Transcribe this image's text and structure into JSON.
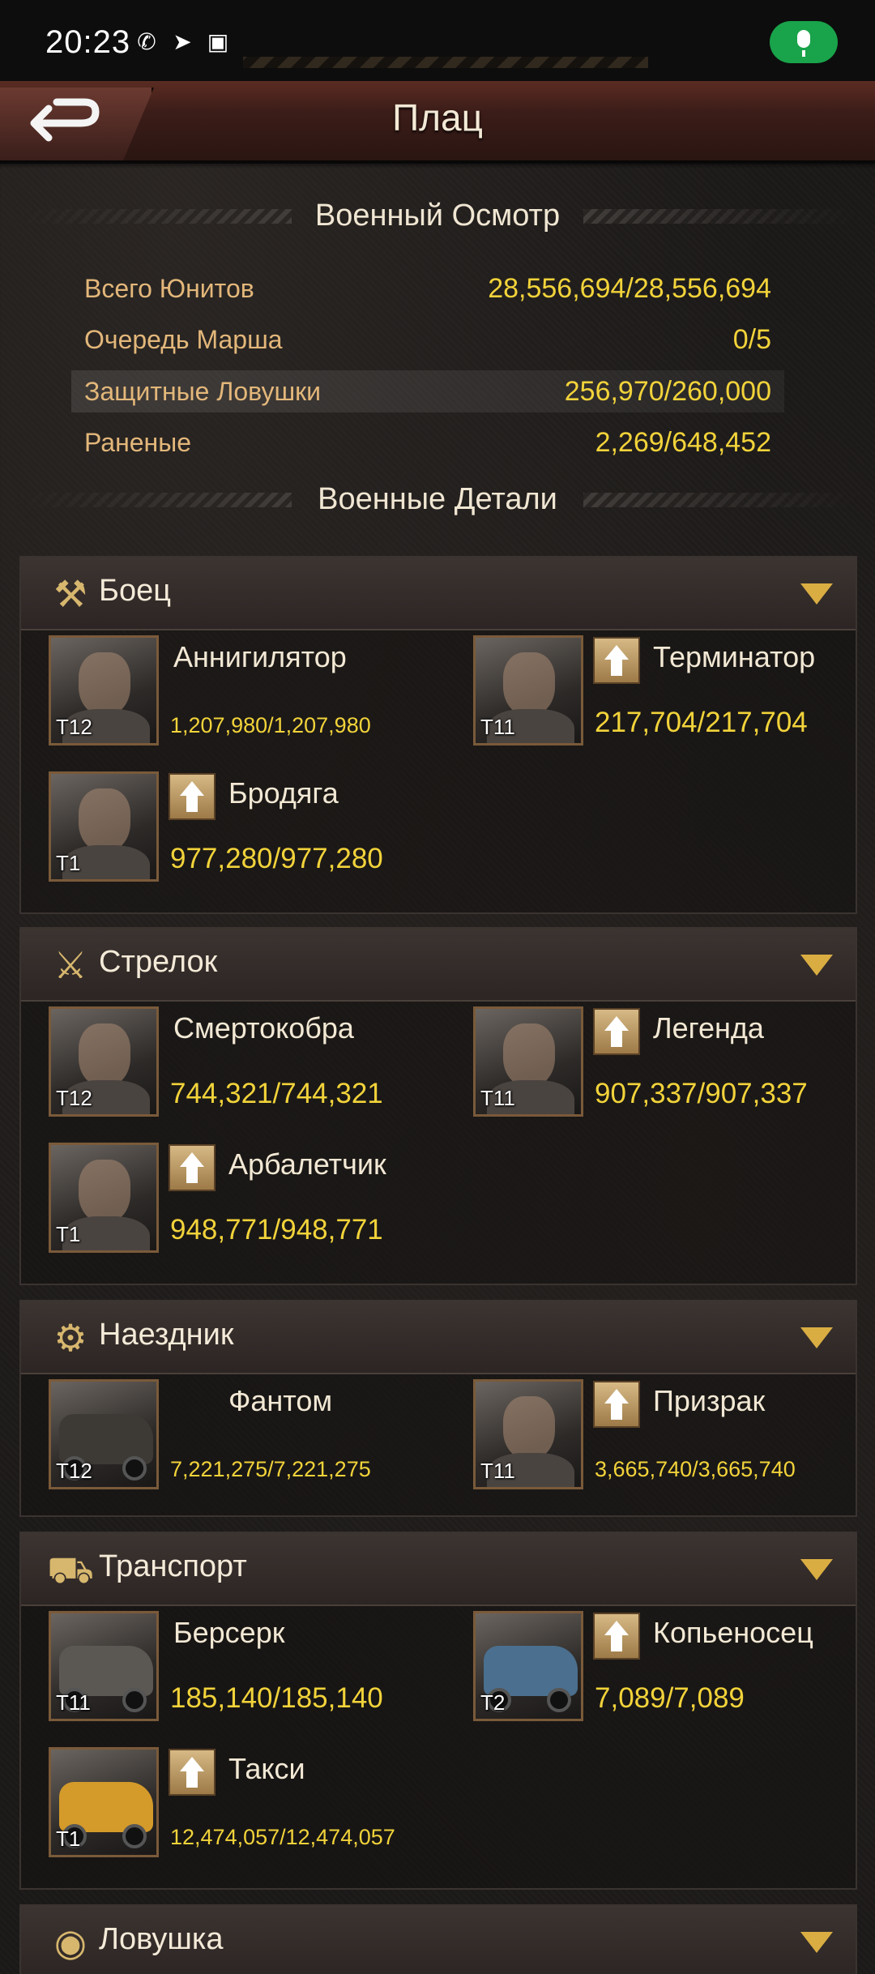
{
  "status_bar": {
    "time": "20:23",
    "icons": [
      "phone-icon",
      "telegram-icon",
      "nfc-icon"
    ],
    "mic_color": "#19a34a"
  },
  "header": {
    "title": "Плац",
    "back_icon": "back-arrow-icon"
  },
  "overview": {
    "heading": "Военный Осмотр",
    "rows": [
      {
        "label": "Всего Юнитов",
        "value": "28,556,694/28,556,694"
      },
      {
        "label": "Очередь Марша",
        "value": "0/5"
      },
      {
        "label": "Защитные Ловушки",
        "value": "256,970/260,000"
      },
      {
        "label": "Раненые",
        "value": "2,269/648,452"
      }
    ]
  },
  "details_heading": "Военные Детали",
  "categories": [
    {
      "title": "Боец",
      "icon": "axe-icon",
      "units": [
        {
          "name": "Аннигилятор",
          "tier": "T12",
          "count": "1,207,980/1,207,980",
          "upgrade": false
        },
        {
          "name": "Терминатор",
          "tier": "T11",
          "count": "217,704/217,704",
          "upgrade": true
        },
        {
          "name": "Бродяга",
          "tier": "T1",
          "count": "977,280/977,280",
          "upgrade": true
        }
      ]
    },
    {
      "title": "Стрелок",
      "icon": "rifle-icon",
      "units": [
        {
          "name": "Смертокобра",
          "tier": "T12",
          "count": "744,321/744,321",
          "upgrade": false
        },
        {
          "name": "Легенда",
          "tier": "T11",
          "count": "907,337/907,337",
          "upgrade": true
        },
        {
          "name": "Арбалетчик",
          "tier": "T1",
          "count": "948,771/948,771",
          "upgrade": true
        }
      ]
    },
    {
      "title": "Наездник",
      "icon": "motorcycle-icon",
      "units": [
        {
          "name": "Фантом",
          "tier": "T12",
          "count": "7,221,275/7,221,275",
          "upgrade": false
        },
        {
          "name": "Призрак",
          "tier": "T11",
          "count": "3,665,740/3,665,740",
          "upgrade": true
        }
      ]
    },
    {
      "title": "Транспорт",
      "icon": "car-icon",
      "units": [
        {
          "name": "Берсерк",
          "tier": "T11",
          "count": "185,140/185,140",
          "upgrade": false
        },
        {
          "name": "Копьеносец",
          "tier": "T2",
          "count": "7,089/7,089",
          "upgrade": true
        },
        {
          "name": "Такси",
          "tier": "T1",
          "count": "12,474,057/12,474,057",
          "upgrade": true
        }
      ]
    },
    {
      "title": "Ловушка",
      "icon": "trap-icon",
      "units": []
    }
  ],
  "colors": {
    "accent_gold": "#f2d33a",
    "label_tan": "#e3b77a",
    "arrow_gold": "#d9ad42"
  }
}
